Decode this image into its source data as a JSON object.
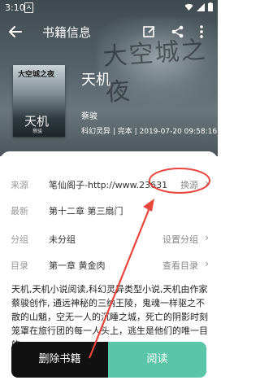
{
  "status_bar": {
    "time": "3:10",
    "sim_label": "A"
  },
  "toolbar": {
    "title": "书籍信息",
    "icons": [
      "back-arrow-icon",
      "edit-icon",
      "share-icon",
      "more-vert-icon"
    ]
  },
  "book": {
    "cover_top_text": "大空城之夜",
    "cover_title": "天机",
    "cover_author": "蔡骏",
    "hero_bg_text": "大空城之夜",
    "title": "天机",
    "author": "蔡骏",
    "meta": "科幻灵异 | 完本 | 2019-07-20 09:58:16"
  },
  "info_rows": [
    {
      "label": "来源",
      "value": "笔仙阁子-http://www.23631",
      "action": "换源",
      "chevron": "›"
    },
    {
      "label": "最新",
      "value": "第十二章 第三扇门",
      "action": "",
      "chevron": ""
    },
    {
      "label": "分组",
      "value": "未分组",
      "action": "设置分组",
      "chevron": "›"
    },
    {
      "label": "目录",
      "value": "第一章 黄金肉",
      "action": "查看目录",
      "chevron": "›"
    }
  ],
  "description": "天机,天机小说阅读,科幻灵异类型小说,天机由作家蔡骏创作, 通远神秘的三纳王陵，鬼魂一样驱之不散的山魈，空无一人的沉睡之城，死亡的阴影时刻笼罩在旅行团的每一人头上，逃生是他们的唯一目的。",
  "buttons": {
    "delete": "删除书籍",
    "read": "阅读"
  },
  "colors": {
    "accent": "#5ac5a8",
    "annotation": "#e8453c",
    "dark": "#111111"
  }
}
